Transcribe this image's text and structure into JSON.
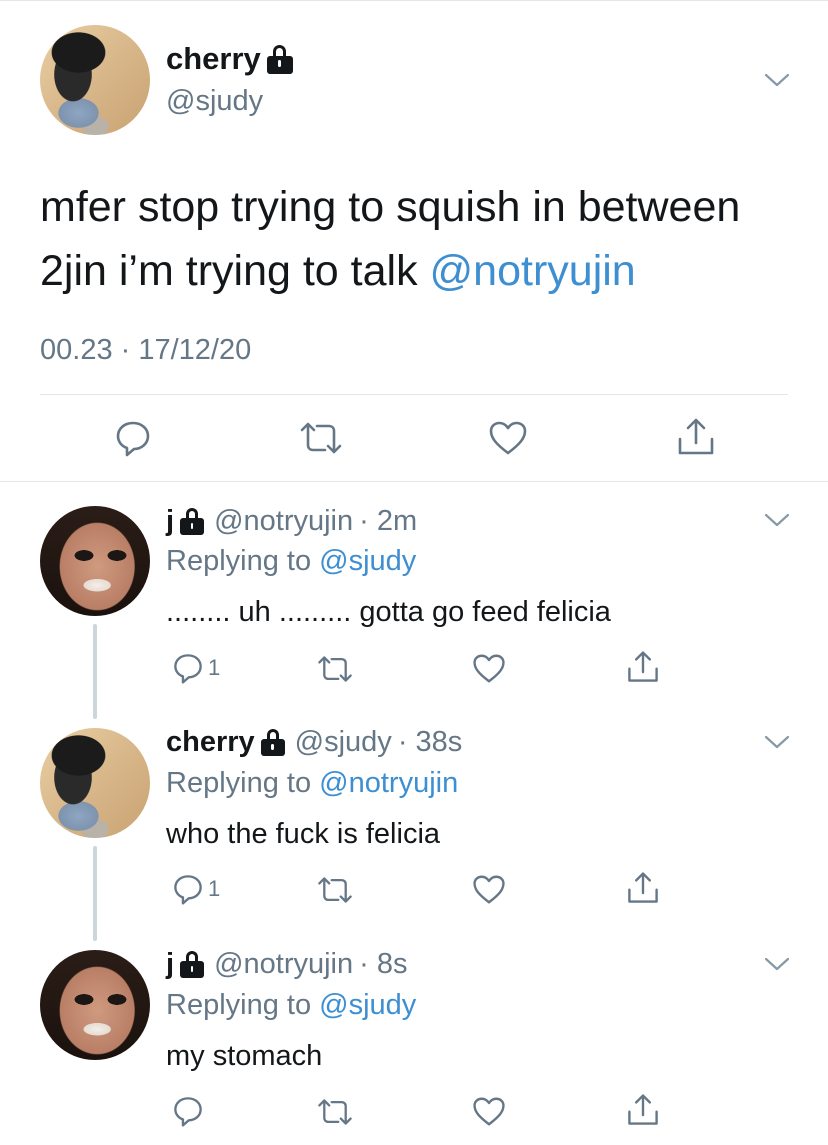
{
  "main_tweet": {
    "display_name": "cherry",
    "handle": "@sjudy",
    "text_line1": "mfer stop trying to squish in between",
    "text_line2_prefix": "2jin i’m trying to talk ",
    "text_line2_mention": "@notryujin",
    "timestamp": "00.23 · 17/12/20",
    "icons": [
      "reply-icon",
      "retweet-icon",
      "like-icon",
      "share-icon"
    ]
  },
  "replies": [
    {
      "display_name": "j",
      "handle": "@notryujin",
      "time": "· 2m",
      "replying_prefix": "Replying to ",
      "replying_to": "@sjudy",
      "text": "........ uh ......... gotta go feed felicia",
      "reply_count": "1"
    },
    {
      "display_name": "cherry",
      "handle": "@sjudy",
      "time": "· 38s",
      "replying_prefix": "Replying to ",
      "replying_to": "@notryujin",
      "text": "who the fuck is felicia",
      "reply_count": "1"
    },
    {
      "display_name": "j",
      "handle": "@notryujin",
      "time": "· 8s",
      "replying_prefix": "Replying to ",
      "replying_to": "@sjudy",
      "text": "my stomach",
      "reply_count": ""
    }
  ],
  "colors": {
    "text": "#14171a",
    "secondary": "#657786",
    "link": "#3d8fd1",
    "divider": "#e1e8ed",
    "thread_line": "#ccd6dd"
  }
}
